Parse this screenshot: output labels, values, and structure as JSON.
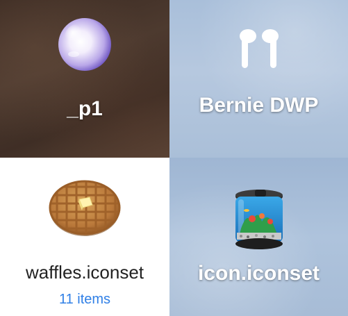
{
  "items": [
    {
      "name": "_p1",
      "icon": "glossy-sphere-icon"
    },
    {
      "name": "Bernie DWP",
      "icon": "airpods-icon"
    },
    {
      "name": "waffles.iconset",
      "subtitle": "11 items",
      "icon": "waffle-icon"
    },
    {
      "name": "icon.iconset",
      "icon": "aquarium-icon"
    }
  ],
  "colors": {
    "subtitle": "#2f7fe6",
    "label_dark": "#ffffff",
    "label_light": "#222222"
  }
}
